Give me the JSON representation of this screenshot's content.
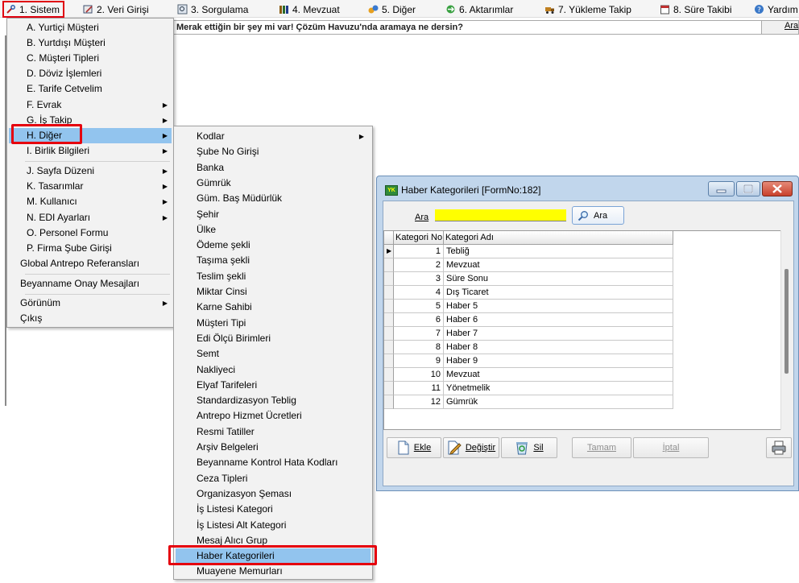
{
  "menubar": {
    "items": [
      {
        "label": "1.  Sistem"
      },
      {
        "label": "2.  Veri Girişi"
      },
      {
        "label": "3.  Sorgulama"
      },
      {
        "label": "4.  Mevzuat"
      },
      {
        "label": "5.  Diğer"
      },
      {
        "label": "6.  Aktarımlar"
      },
      {
        "label": "7.  Yükleme Takip"
      },
      {
        "label": "8. Süre Takibi"
      },
      {
        "label": "Yardım"
      }
    ]
  },
  "searchbar": {
    "hint": "Merak ettiğin bir şey mi var! Çözüm Havuzu'nda aramaya ne dersin?",
    "button": "Ara"
  },
  "sistem_menu": {
    "items": [
      {
        "label": "A.  Yurtiçi Müşteri",
        "sub": false
      },
      {
        "label": "B.  Yurtdışı Müşteri",
        "sub": false
      },
      {
        "label": "C.  Müşteri Tipleri",
        "sub": false
      },
      {
        "label": "D.  Döviz İşlemleri",
        "sub": false
      },
      {
        "label": "E.  Tarife Cetvelim",
        "sub": false
      },
      {
        "label": "F.  Evrak",
        "sub": true
      },
      {
        "label": "G.  İş Takip",
        "sub": true
      },
      {
        "label": "H.  Diğer",
        "sub": true
      },
      {
        "label": "I.  Birlik Bilgileri",
        "sub": true
      },
      {
        "label": "J.  Sayfa Düzeni",
        "sub": true
      },
      {
        "label": "K.  Tasarımlar",
        "sub": true
      },
      {
        "label": "M.  Kullanıcı",
        "sub": true
      },
      {
        "label": "N.  EDI Ayarları",
        "sub": true
      },
      {
        "label": "O.  Personel Formu",
        "sub": false
      },
      {
        "label": "P.  Firma Şube Girişi",
        "sub": false
      },
      {
        "label": "Global Antrepo Referansları",
        "sub": false
      },
      {
        "label": "Beyanname Onay Mesajları",
        "sub": false
      },
      {
        "label": "Görünüm",
        "sub": true
      },
      {
        "label": "Çıkış",
        "sub": false
      }
    ]
  },
  "diger_submenu": {
    "items": [
      "Kodlar",
      "Şube No Girişi",
      "Banka",
      "Gümrük",
      "Güm. Baş Müdürlük",
      "Şehir",
      "Ülke",
      "Ödeme şekli",
      "Taşıma şekli",
      "Teslim şekli",
      "Miktar Cinsi",
      "Karne Sahibi",
      "Müşteri  Tipi",
      "Edi Ölçü Birimleri",
      "Semt",
      "Nakliyeci",
      "Elyaf Tarifeleri",
      "Standardizasyon Teblig",
      "Antrepo Hizmet Ücretleri",
      "Resmi Tatiller",
      "Arşiv Belgeleri",
      "Beyanname Kontrol Hata Kodları",
      "Ceza Tipleri",
      "Organizasyon Şeması",
      "İş Listesi Kategori",
      "İş Listesi Alt Kategori",
      "Mesaj Alıcı Grup",
      "Haber Kategorileri",
      "Muayene Memurları"
    ]
  },
  "dialog": {
    "title": "Haber Kategorileri [FormNo:182]",
    "icon_text": "YK",
    "search_label": "Ara",
    "search_value": "",
    "search_button": "Ara",
    "grid": {
      "columns": [
        "Kategori No",
        "Kategori Adı"
      ],
      "rows": [
        {
          "no": "1",
          "ad": "Tebliğ"
        },
        {
          "no": "2",
          "ad": "Mevzuat"
        },
        {
          "no": "3",
          "ad": "Süre Sonu"
        },
        {
          "no": "4",
          "ad": "Dış Ticaret"
        },
        {
          "no": "5",
          "ad": "Haber 5"
        },
        {
          "no": "6",
          "ad": "Haber 6"
        },
        {
          "no": "7",
          "ad": "Haber 7"
        },
        {
          "no": "8",
          "ad": "Haber 8"
        },
        {
          "no": "9",
          "ad": "Haber 9"
        },
        {
          "no": "10",
          "ad": "Mevzuat"
        },
        {
          "no": "11",
          "ad": "Yönetmelik"
        },
        {
          "no": "12",
          "ad": "Gümrük"
        }
      ]
    },
    "buttons": {
      "ekle": "Ekle",
      "degistir": "Değiştir",
      "sil": "Sil",
      "tamam": "Tamam",
      "iptal": "İptal"
    }
  },
  "colors": {
    "highlight": "#e5000e",
    "menu_active": "#92c4ee",
    "search_field": "#ffff00",
    "dialog_frame": "#c1d6ec"
  }
}
